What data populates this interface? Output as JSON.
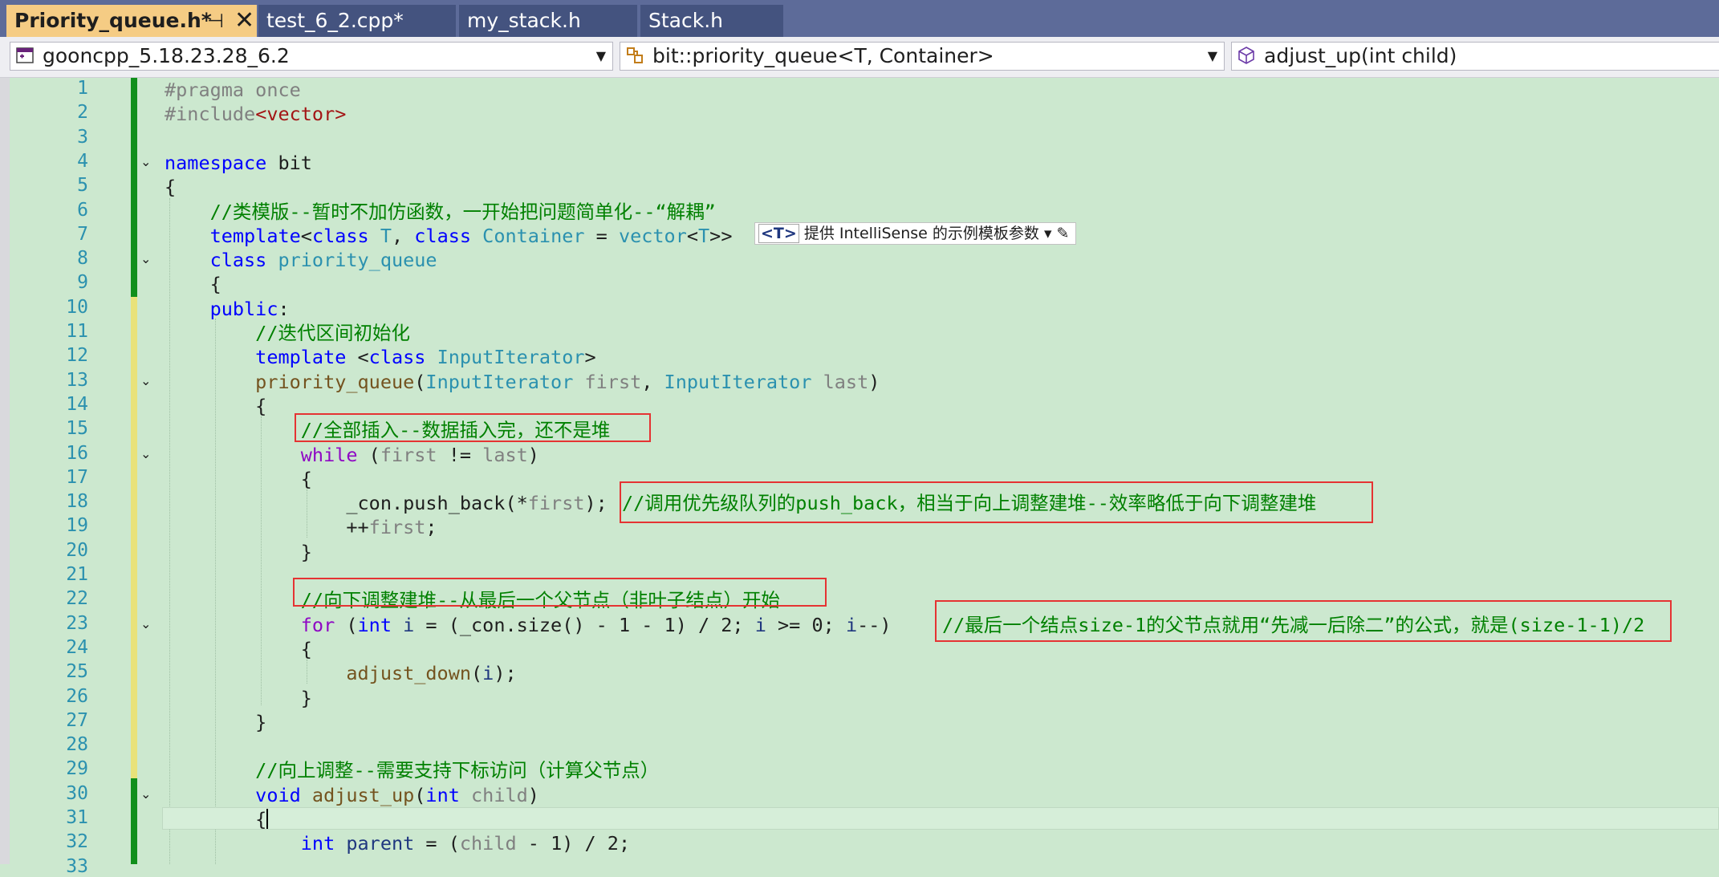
{
  "tabs": [
    {
      "label": "Priority_queue.h*",
      "pin": "⊣",
      "close": "✕"
    },
    {
      "label": "test_6_2.cpp*"
    },
    {
      "label": "my_stack.h"
    },
    {
      "label": "Stack.h"
    }
  ],
  "nav": {
    "project": "gooncpp_5.18.23.28_6.2",
    "scope": "bit::priority_queue<T, Container>",
    "member": "adjust_up(int child)"
  },
  "intellisense_hint": {
    "tag": "<T>",
    "text": "提供 IntelliSense 的示例模板参数",
    "arrow": "▾",
    "edit": "✎"
  },
  "line_numbers": [
    "1",
    "2",
    "3",
    "4",
    "5",
    "6",
    "7",
    "8",
    "9",
    "10",
    "11",
    "12",
    "13",
    "14",
    "15",
    "16",
    "17",
    "18",
    "19",
    "20",
    "21",
    "22",
    "23",
    "24",
    "25",
    "26",
    "27",
    "28",
    "29",
    "30",
    "31",
    "32",
    "33"
  ],
  "code": {
    "l1a": "#pragma once",
    "l2a": "#include",
    "l2b": "<vector>",
    "l4a": "namespace",
    "l4b": " bit",
    "l5": "{",
    "l6": "    //类模版--暂时不加仿函数，一开始把问题简单化--“解耦”",
    "l7a": "    template",
    "l7b": "<",
    "l7c": "class",
    "l7d": " T",
    "l7e": ", ",
    "l7f": "class",
    "l7g": " Container",
    "l7h": " = ",
    "l7i": "vector",
    "l7j": "<",
    "l7k": "T",
    "l7l": ">>",
    "l8a": "    class",
    "l8b": " priority_queue",
    "l9": "    {",
    "l10a": "    public",
    "l10b": ":",
    "l11": "        //迭代区间初始化",
    "l12a": "        template",
    "l12b": " <",
    "l12c": "class",
    "l12d": " InputIterator",
    "l12e": ">",
    "l13a": "        priority_queue",
    "l13b": "(",
    "l13c": "InputIterator",
    "l13d": " first",
    "l13e": ", ",
    "l13f": "InputIterator",
    "l13g": " last",
    "l13h": ")",
    "l14": "        {",
    "l15": "            //全部插入--数据插入完，还不是堆",
    "l16a": "            while",
    "l16b": " (",
    "l16c": "first",
    "l16d": " != ",
    "l16e": "last",
    "l16f": ")",
    "l17": "            {",
    "l18a": "                _con.push_back(*",
    "l18b": "first",
    "l18c": ");",
    "l18d": "//调用优先级队列的push_back，相当于向上调整建堆--效率略低于向下调整建堆",
    "l19a": "                ++",
    "l19b": "first",
    "l19c": ";",
    "l20": "            }",
    "l22": "            //向下调整建堆--从最后一个父节点（非叶子结点）开始",
    "l23a": "            for",
    "l23b": " (",
    "l23c": "int",
    "l23d": " i",
    "l23e": " = (_con.size() - 1 - 1) / 2; ",
    "l23f": "i",
    "l23g": " >= 0; ",
    "l23h": "i",
    "l23i": "--)",
    "l23j": "//最后一个结点size-1的父节点就用“先减一后除二”的公式，就是(size-1-1)/2",
    "l24": "            {",
    "l25a": "                adjust_down",
    "l25b": "(",
    "l25c": "i",
    "l25d": ");",
    "l26": "            }",
    "l27": "        }",
    "l29": "        //向上调整--需要支持下标访问（计算父节点）",
    "l30a": "        void",
    "l30b": " adjust_up",
    "l30c": "(",
    "l30d": "int",
    "l30e": " child",
    "l30f": ")",
    "l31": "        {",
    "l32a": "            int",
    "l32b": " parent",
    "l32c": " = (",
    "l32d": "child",
    "l32e": " - 1) / 2;"
  },
  "colors": {
    "editor_bg": "#cce8cf",
    "tabstrip_bg": "#5d6b99",
    "active_tab": "#f5cc84",
    "keyword": "#0000ff",
    "comment": "#008000",
    "type": "#2b91af",
    "annotation_box": "#e53333"
  }
}
